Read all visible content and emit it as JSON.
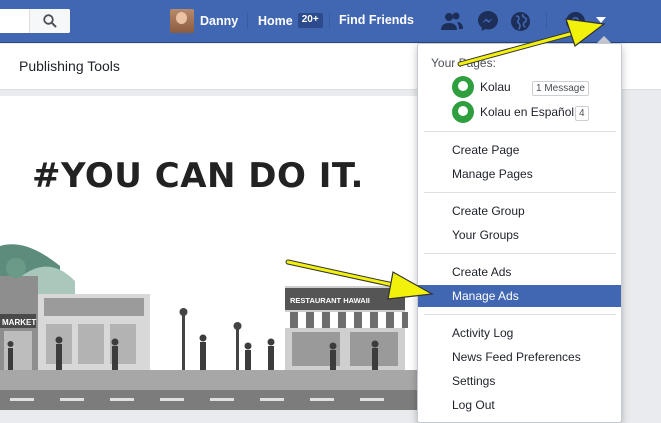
{
  "header": {
    "user_name": "Danny",
    "home_label": "Home",
    "home_badge": "20+",
    "find_friends_label": "Find Friends"
  },
  "subnav": {
    "publishing_tools_label": "Publishing Tools"
  },
  "cover": {
    "slogan": "#YOU CAN DO IT.",
    "sign_left": "MARKET",
    "sign_restaurant": "RESTAURANT HAWAII"
  },
  "menu": {
    "heading": "Your Pages:",
    "pages": [
      {
        "name": "Kolau",
        "badge": "1 Message"
      },
      {
        "name": "Kolau en Español",
        "badge": "4"
      }
    ],
    "items": [
      "Create Page",
      "Manage Pages",
      "Create Group",
      "Your Groups",
      "Create Ads",
      "Manage Ads",
      "Activity Log",
      "News Feed Preferences",
      "Settings",
      "Log Out"
    ],
    "active_item": "Manage Ads"
  },
  "colors": {
    "brand": "#4267b2",
    "highlight": "#4267b2",
    "arrow": "#f1f10c"
  },
  "icons": [
    "search-icon",
    "friend-requests-icon",
    "messenger-icon",
    "notifications-globe-icon",
    "help-icon",
    "account-dropdown-icon"
  ]
}
